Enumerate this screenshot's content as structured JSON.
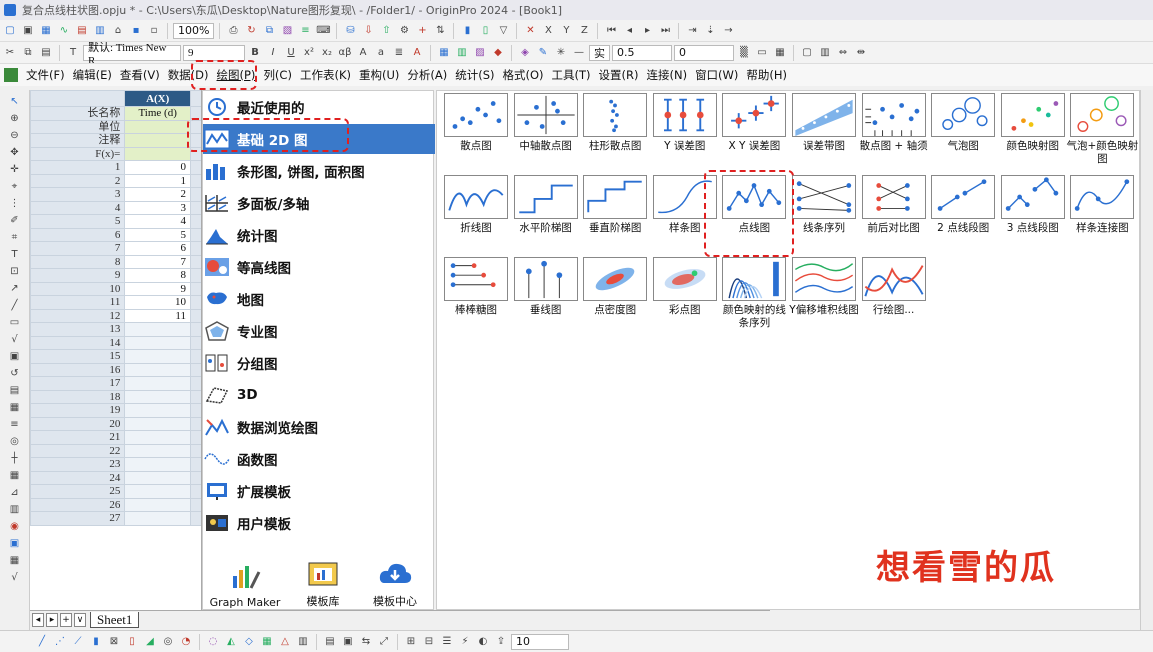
{
  "window": {
    "title": "复合点线柱状图.opju * - C:\\Users\\东瓜\\Desktop\\Nature图形复现\\ - /Folder1/ - OriginPro 2024 - [Book1]"
  },
  "toolbar": {
    "zoom": "100%",
    "font_name": "默认: Times New R",
    "font_size": "9",
    "bold": "B",
    "italic": "I",
    "underline": "U",
    "line_label": "实",
    "line_width": "0.5",
    "size_value": "0",
    "bottom_size": "10"
  },
  "menu": {
    "items": [
      "文件(F)",
      "编辑(E)",
      "查看(V)",
      "数据(D)",
      "绘图(P)",
      "列(C)",
      "工作表(K)",
      "重构(U)",
      "分析(A)",
      "统计(S)",
      "格式(O)",
      "工具(T)",
      "设置(R)",
      "连接(N)",
      "窗口(W)",
      "帮助(H)"
    ]
  },
  "worksheet": {
    "col_header": "A(X)",
    "label_rows": [
      {
        "name": "长名称",
        "value": "Time (d)"
      },
      {
        "name": "单位",
        "value": ""
      },
      {
        "name": "注释",
        "value": ""
      },
      {
        "name": "F(x)=",
        "value": ""
      }
    ],
    "rows": [
      {
        "n": "1",
        "v": "0"
      },
      {
        "n": "2",
        "v": "1"
      },
      {
        "n": "3",
        "v": "2"
      },
      {
        "n": "4",
        "v": "3"
      },
      {
        "n": "5",
        "v": "4"
      },
      {
        "n": "6",
        "v": "5"
      },
      {
        "n": "7",
        "v": "6"
      },
      {
        "n": "8",
        "v": "7"
      },
      {
        "n": "9",
        "v": "8"
      },
      {
        "n": "10",
        "v": "9"
      },
      {
        "n": "11",
        "v": "10"
      },
      {
        "n": "12",
        "v": "11"
      },
      {
        "n": "13",
        "v": ""
      },
      {
        "n": "14",
        "v": ""
      },
      {
        "n": "15",
        "v": ""
      },
      {
        "n": "16",
        "v": ""
      },
      {
        "n": "17",
        "v": ""
      },
      {
        "n": "18",
        "v": ""
      },
      {
        "n": "19",
        "v": ""
      },
      {
        "n": "20",
        "v": ""
      },
      {
        "n": "21",
        "v": ""
      },
      {
        "n": "22",
        "v": ""
      },
      {
        "n": "23",
        "v": ""
      },
      {
        "n": "24",
        "v": ""
      },
      {
        "n": "25",
        "v": ""
      },
      {
        "n": "26",
        "v": ""
      },
      {
        "n": "27",
        "v": ""
      }
    ],
    "sheet_tab": "Sheet1"
  },
  "categories": [
    {
      "label": "最近使用的",
      "icon": "recent-icon"
    },
    {
      "label": "基础 2D 图",
      "icon": "basic-2d-icon",
      "active": true
    },
    {
      "label": "条形图, 饼图, 面积图",
      "icon": "bar-pie-area-icon"
    },
    {
      "label": "多面板/多轴",
      "icon": "multi-panel-icon"
    },
    {
      "label": "统计图",
      "icon": "statistics-icon"
    },
    {
      "label": "等高线图",
      "icon": "contour-icon"
    },
    {
      "label": "地图",
      "icon": "map-icon"
    },
    {
      "label": "专业图",
      "icon": "specialized-icon"
    },
    {
      "label": "分组图",
      "icon": "grouped-icon"
    },
    {
      "label": "3D",
      "icon": "3d-icon"
    },
    {
      "label": "数据浏览绘图",
      "icon": "data-explore-icon"
    },
    {
      "label": "函数图",
      "icon": "function-icon"
    },
    {
      "label": "扩展模板",
      "icon": "extension-icon"
    },
    {
      "label": "用户模板",
      "icon": "user-template-icon"
    }
  ],
  "launchers": [
    "Graph Maker",
    "模板库",
    "模板中心"
  ],
  "gallery": [
    {
      "label": "散点图",
      "kind": "scatter"
    },
    {
      "label": "中轴散点图",
      "kind": "scatter-central"
    },
    {
      "label": "柱形散点图",
      "kind": "column-scatter"
    },
    {
      "label": "Y 误差图",
      "kind": "y-error"
    },
    {
      "label": "X Y 误差图",
      "kind": "xy-error"
    },
    {
      "label": "误差带图",
      "kind": "error-band"
    },
    {
      "label": "散点图 + 轴须",
      "kind": "scatter-rug"
    },
    {
      "label": "气泡图",
      "kind": "bubble"
    },
    {
      "label": "颜色映射图",
      "kind": "color-map"
    },
    {
      "label": "气泡+颜色映射图",
      "kind": "bubble-color"
    },
    {
      "label": "折线图",
      "kind": "line"
    },
    {
      "label": "水平阶梯图",
      "kind": "step-h"
    },
    {
      "label": "垂直阶梯图",
      "kind": "step-v"
    },
    {
      "label": "样条图",
      "kind": "spline"
    },
    {
      "label": "点线图",
      "kind": "line-symbol"
    },
    {
      "label": "线条序列",
      "kind": "line-series"
    },
    {
      "label": "前后对比图",
      "kind": "before-after"
    },
    {
      "label": "2 点线段图",
      "kind": "seg2"
    },
    {
      "label": "3 点线段图",
      "kind": "seg3"
    },
    {
      "label": "样条连接图",
      "kind": "spline-connected"
    },
    {
      "label": "棒棒糖图",
      "kind": "lollipop"
    },
    {
      "label": "垂线图",
      "kind": "drop-line"
    },
    {
      "label": "点密度图",
      "kind": "density-dots"
    },
    {
      "label": "彩点图",
      "kind": "color-dots"
    },
    {
      "label": "颜色映射的线条序列",
      "kind": "colormap-lines"
    },
    {
      "label": "Y偏移堆积线图",
      "kind": "y-offset"
    },
    {
      "label": "行绘图...",
      "kind": "plot-by-row"
    }
  ],
  "watermark": "想看雪的瓜",
  "colors": {
    "accent": "#3a79c9",
    "header": "#2d5a86",
    "highlight": "#e02020",
    "watermark": "#e0321e"
  }
}
